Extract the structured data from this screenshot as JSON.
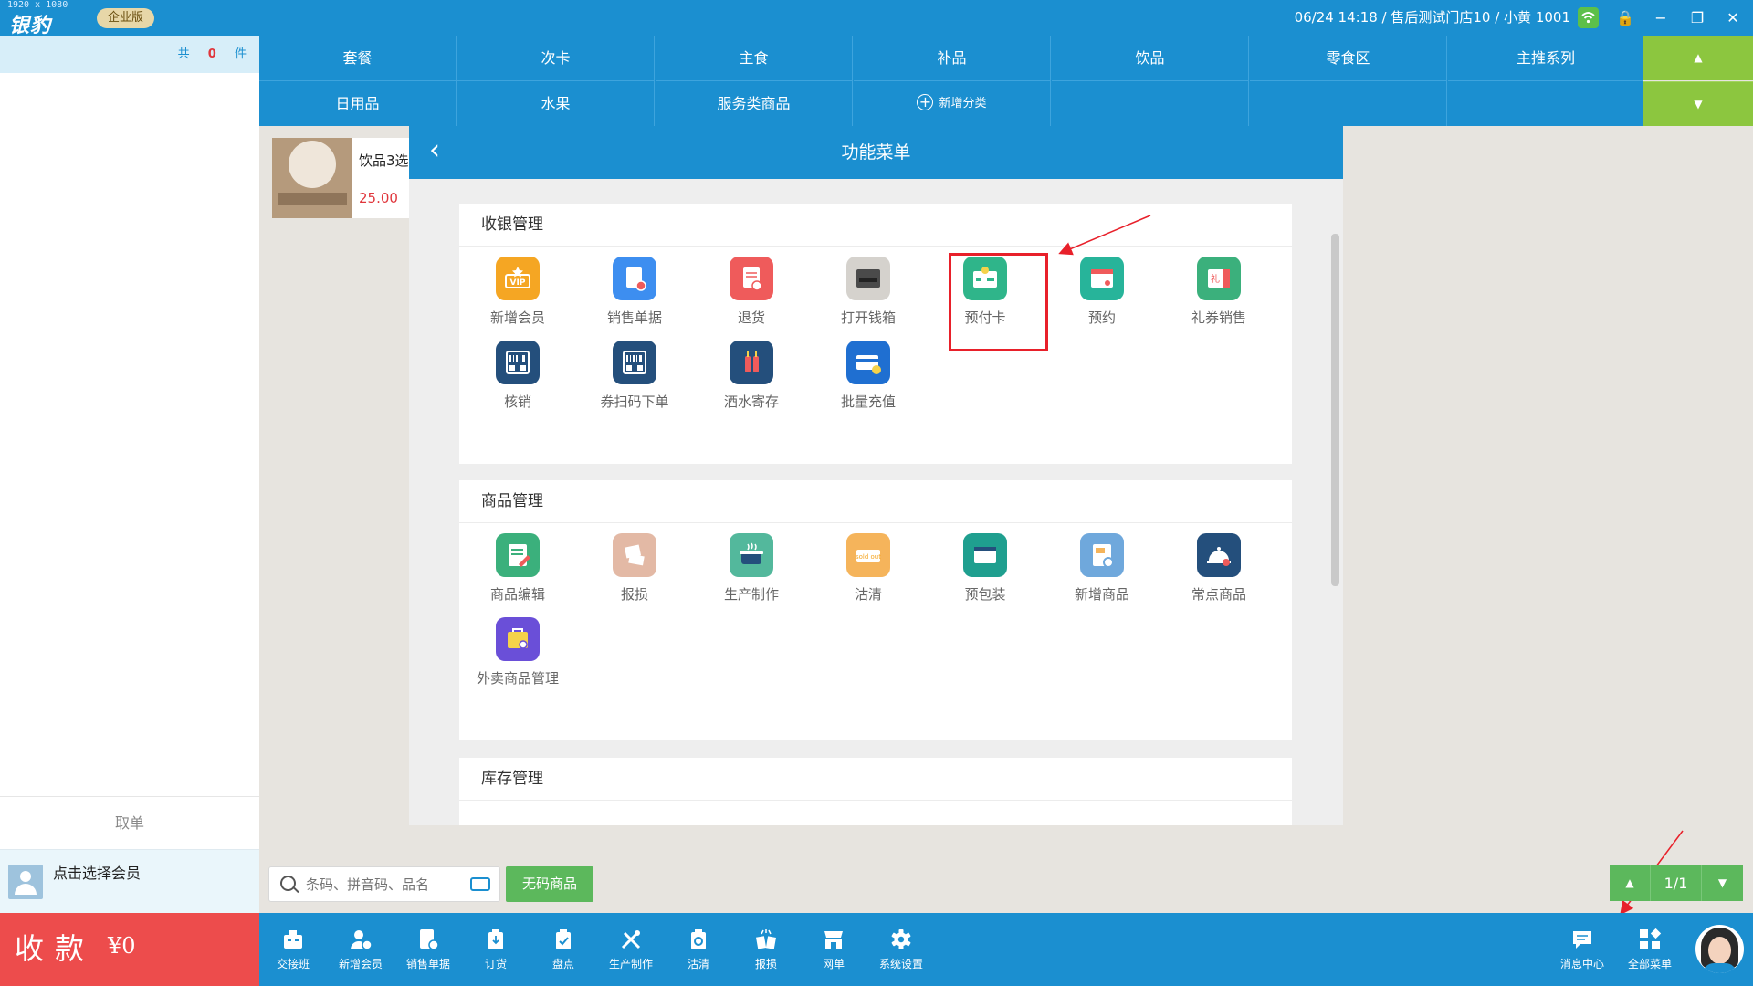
{
  "app": {
    "resolution": "1920 x 1080",
    "brand": "银豹",
    "edition": "企业版",
    "status": "06/24 14:18 / 售后测试门店10 / 小黄 1001"
  },
  "window_controls": {
    "lock": "🔒",
    "minimize": "−",
    "restore": "❐",
    "close": "✕"
  },
  "cart": {
    "total_prefix": "共",
    "count": "0",
    "unit": "件",
    "cancel_label": "取单",
    "member_prompt": "点击选择会员"
  },
  "pay": {
    "label": "收款",
    "amount": "¥0"
  },
  "categories": {
    "row1": [
      "套餐",
      "次卡",
      "主食",
      "补品",
      "饮品",
      "零食区",
      "主推系列"
    ],
    "row2": [
      "日用品",
      "水果",
      "服务类商品"
    ],
    "add_label": "新增分类",
    "up_arrow": "▲",
    "down_arrow": "▼"
  },
  "product": {
    "name": "饮品3选",
    "price": "25.00"
  },
  "menu": {
    "title": "功能菜单",
    "back": "‹",
    "sections": [
      {
        "title": "收银管理",
        "items": [
          {
            "label": "新增会员",
            "icon": "vip-icon",
            "color": "#f5a623"
          },
          {
            "label": "销售单据",
            "icon": "sales-receipt-icon",
            "color": "#3d8ef0"
          },
          {
            "label": "退货",
            "icon": "return-icon",
            "color": "#ef5b5b"
          },
          {
            "label": "打开钱箱",
            "icon": "cash-drawer-icon",
            "color": "#d5d2cd"
          },
          {
            "label": "预付卡",
            "icon": "prepaid-card-icon",
            "color": "#2fb58a"
          },
          {
            "label": "预约",
            "icon": "calendar-icon",
            "color": "#27b49a"
          },
          {
            "label": "礼券销售",
            "icon": "gift-voucher-icon",
            "color": "#3bb07c"
          },
          {
            "label": "核销",
            "icon": "barcode-verify-icon",
            "color": "#244f7c"
          },
          {
            "label": "券扫码下单",
            "icon": "coupon-scan-icon",
            "color": "#244f7c"
          },
          {
            "label": "酒水寄存",
            "icon": "wine-storage-icon",
            "color": "#244f7c"
          },
          {
            "label": "批量充值",
            "icon": "batch-recharge-icon",
            "color": "#1f6fd1"
          }
        ]
      },
      {
        "title": "商品管理",
        "items": [
          {
            "label": "商品编辑",
            "icon": "product-edit-icon",
            "color": "#3bb07c"
          },
          {
            "label": "报损",
            "icon": "damage-report-icon",
            "color": "#e3b9a5"
          },
          {
            "label": "生产制作",
            "icon": "cooking-pot-icon",
            "color": "#53b89c"
          },
          {
            "label": "沽清",
            "icon": "sold-out-icon",
            "color": "#f5b45b"
          },
          {
            "label": "预包装",
            "icon": "prepack-icon",
            "color": "#1f9f8f"
          },
          {
            "label": "新增商品",
            "icon": "new-product-icon",
            "color": "#6fa8dc"
          },
          {
            "label": "常点商品",
            "icon": "cloche-icon",
            "color": "#244f7c"
          },
          {
            "label": "外卖商品管理",
            "icon": "takeout-bag-icon",
            "color": "#6a4fd8"
          }
        ]
      },
      {
        "title": "库存管理",
        "items": []
      }
    ]
  },
  "search": {
    "placeholder": "条码、拼音码、品名",
    "nocode_label": "无码商品"
  },
  "pager": {
    "text": "1/1",
    "up": "▲",
    "down": "▼"
  },
  "toolbar": {
    "items": [
      {
        "label": "交接班",
        "icon": "handover-icon"
      },
      {
        "label": "新增会员",
        "icon": "add-member-icon"
      },
      {
        "label": "销售单据",
        "icon": "sales-receipt-icon"
      },
      {
        "label": "订货",
        "icon": "order-goods-icon"
      },
      {
        "label": "盘点",
        "icon": "stocktake-icon"
      },
      {
        "label": "生产制作",
        "icon": "production-icon"
      },
      {
        "label": "沽清",
        "icon": "sold-out-icon"
      },
      {
        "label": "报损",
        "icon": "damage-icon"
      },
      {
        "label": "网单",
        "icon": "online-order-icon"
      },
      {
        "label": "系统设置",
        "icon": "gear-icon"
      }
    ],
    "message_center": "消息中心",
    "all_menu": "全部菜单"
  },
  "colors": {
    "primary": "#1b8fd0",
    "accent_green": "#8cc63f",
    "pay_red": "#ed4c4c",
    "highlight_red": "#e8202a"
  }
}
